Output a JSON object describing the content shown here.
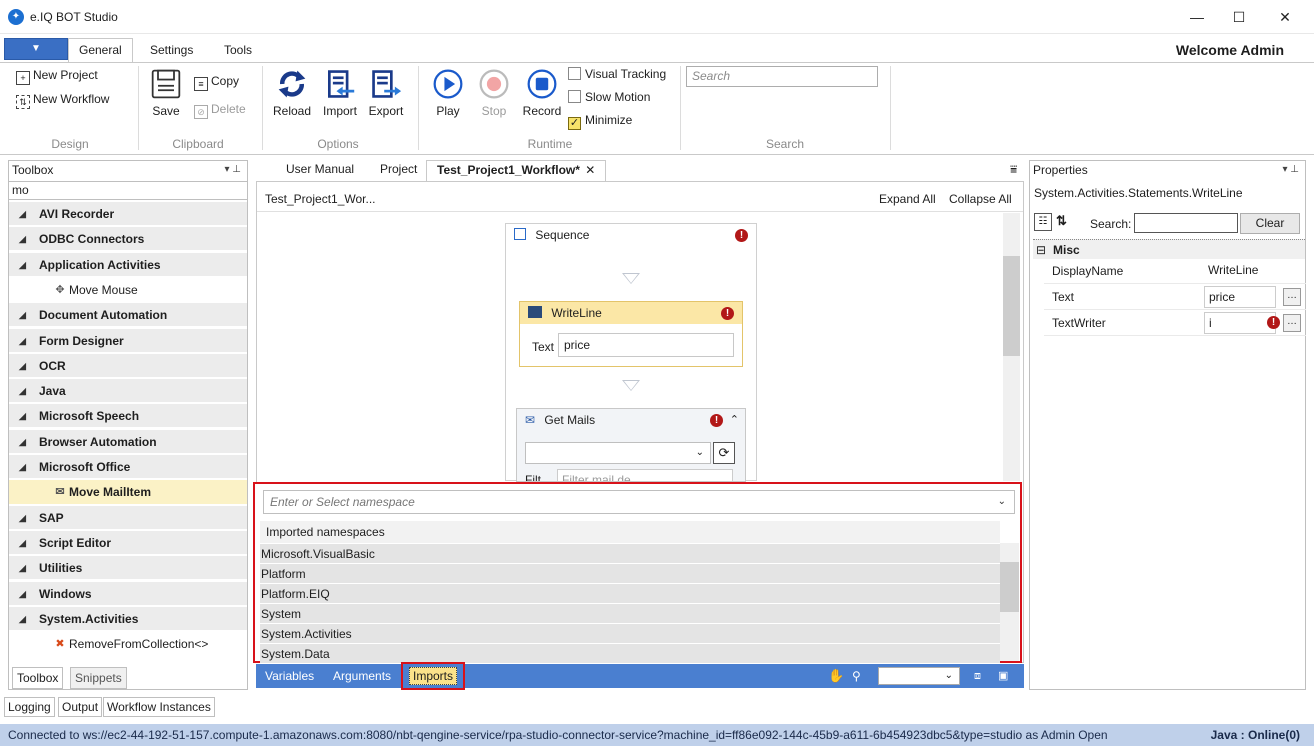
{
  "window": {
    "title": "e.IQ BOT Studio",
    "minimize": "—",
    "maximize": "☐",
    "close": "✕"
  },
  "ribbon": {
    "menu_button": "▼",
    "tabs": [
      "General",
      "Settings",
      "Tools"
    ],
    "welcome": "Welcome  Admin",
    "design": {
      "new_project": "New Project",
      "new_workflow": "New Workflow",
      "label": "Design"
    },
    "clipboard": {
      "save": "Save",
      "copy": "Copy",
      "delete": "Delete",
      "label": "Clipboard"
    },
    "options": {
      "reload": "Reload",
      "import": "Import",
      "export": "Export",
      "label": "Options"
    },
    "runtime": {
      "play": "Play",
      "stop": "Stop",
      "record": "Record",
      "visual_tracking": "Visual Tracking",
      "slow_motion": "Slow Motion",
      "minimize": "Minimize",
      "label": "Runtime"
    },
    "search": {
      "placeholder": "Search",
      "label": "Search"
    }
  },
  "toolbox": {
    "title": "Toolbox",
    "filter": "mo",
    "entries": [
      {
        "kind": "cat",
        "label": "AVI Recorder"
      },
      {
        "kind": "cat",
        "label": "ODBC Connectors"
      },
      {
        "kind": "cat",
        "label": "Application Activities"
      },
      {
        "kind": "item",
        "label": "Move Mouse",
        "icon": "✥"
      },
      {
        "kind": "cat",
        "label": "Document Automation"
      },
      {
        "kind": "cat",
        "label": "Form Designer"
      },
      {
        "kind": "cat",
        "label": "OCR"
      },
      {
        "kind": "cat",
        "label": "Java"
      },
      {
        "kind": "cat",
        "label": "Microsoft Speech"
      },
      {
        "kind": "cat",
        "label": "Browser Automation"
      },
      {
        "kind": "cat",
        "label": "Microsoft Office"
      },
      {
        "kind": "item",
        "label": "Move MailItem",
        "icon": "✉",
        "selected": true
      },
      {
        "kind": "cat",
        "label": "SAP"
      },
      {
        "kind": "cat",
        "label": "Script Editor"
      },
      {
        "kind": "cat",
        "label": "Utilities"
      },
      {
        "kind": "cat",
        "label": "Windows"
      },
      {
        "kind": "cat",
        "label": "System.Activities"
      },
      {
        "kind": "item",
        "label": "RemoveFromCollection<>",
        "icon": "✖"
      }
    ],
    "bottom_tabs": [
      "Toolbox",
      "Snippets"
    ]
  },
  "documents": {
    "tabs": [
      "User Manual",
      "Project",
      "Test_Project1_Workflow*"
    ],
    "close": "✕",
    "breadcrumb": "Test_Project1_Wor...",
    "expand_all": "Expand All",
    "collapse_all": "Collapse All",
    "sequence": {
      "title": "Sequence"
    },
    "writeline": {
      "title": "WriteLine",
      "text_label": "Text",
      "text_value": "price"
    },
    "getmails": {
      "title": "Get Mails",
      "filter_label": "Filt",
      "filter_placeholder": "Filter mail de..."
    }
  },
  "imports": {
    "namespace_placeholder": "Enter or Select namespace",
    "header": "Imported namespaces",
    "namespaces": [
      "Microsoft.VisualBasic",
      "Platform",
      "Platform.EIQ",
      "System",
      "System.Activities",
      "System.Data"
    ]
  },
  "designer_footer": {
    "variables": "Variables",
    "arguments": "Arguments",
    "imports": "Imports"
  },
  "properties": {
    "title": "Properties",
    "type": "System.Activities.Statements.WriteLine",
    "search_label": "Search:",
    "clear": "Clear",
    "category": "Misc",
    "rows": [
      {
        "name": "DisplayName",
        "value": "WriteLine"
      },
      {
        "name": "Text",
        "value": "price"
      },
      {
        "name": "TextWriter",
        "value": "i"
      }
    ]
  },
  "bottom_tabs": [
    "Logging",
    "Output",
    "Workflow Instances"
  ],
  "status": {
    "connection": "Connected to ws://ec2-44-192-51-157.compute-1.amazonaws.com:8080/nbt-qengine-service/rpa-studio-connector-service?machine_id=ff86e092-144c-45b9-a611-6b454923dbc5&type=studio as Admin  Open",
    "java": "Java : Online(0)"
  }
}
